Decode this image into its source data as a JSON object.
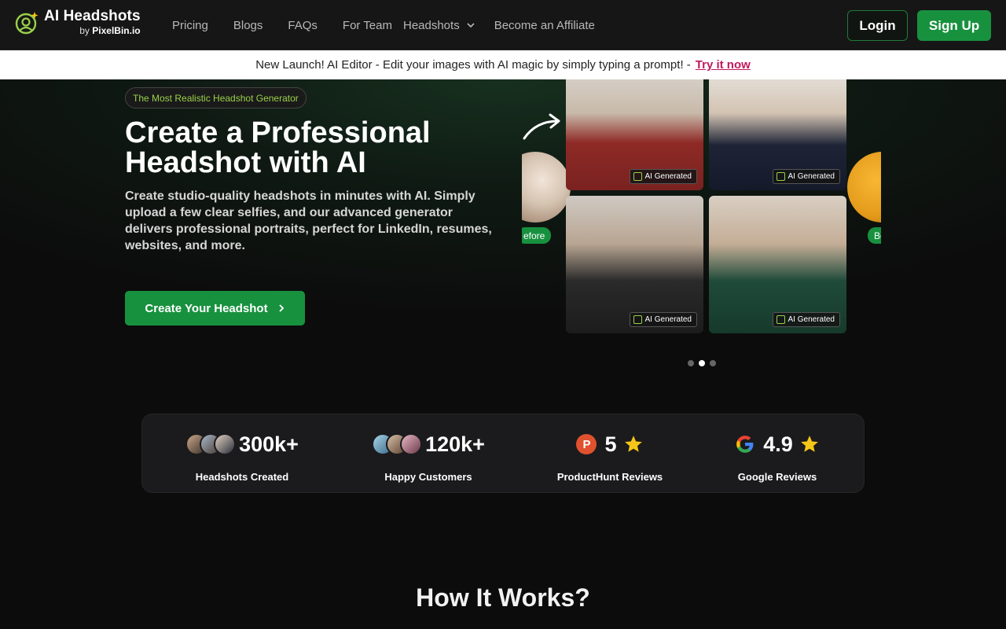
{
  "brand": {
    "name": "AI Headshots",
    "by_prefix": "by",
    "by_name": "PixelBin.io",
    "accent": "#9ad04a"
  },
  "nav": {
    "links": [
      "Pricing",
      "Blogs",
      "FAQs",
      "For Team"
    ],
    "dropdown": "Headshots",
    "affiliate": "Become an Affiliate",
    "login": "Login",
    "signup": "Sign Up"
  },
  "announcement": {
    "text": "New Launch! AI Editor - Edit your images with AI magic by simply typing a prompt! -",
    "link": "Try it now"
  },
  "hero": {
    "pill": "The Most Realistic Headshot Generator",
    "title": "Create a Professional Headshot with AI",
    "subtitle": "Create studio-quality headshots in minutes with AI. Simply upload a few clear selfies, and our advanced generator delivers professional portraits, perfect for LinkedIn, resumes, websites, and more.",
    "cta": "Create Your Headshot"
  },
  "carousel": {
    "badge": "AI Generated",
    "left_tag": "efore",
    "right_tag": "Be",
    "dots": 3,
    "active_dot": 1
  },
  "stats": [
    {
      "value": "300k+",
      "label": "Headshots Created",
      "icon": "avatars"
    },
    {
      "value": "120k+",
      "label": "Happy Customers",
      "icon": "avatars"
    },
    {
      "value": "5",
      "label": "ProductHunt Reviews",
      "icon": "producthunt-icon",
      "ph_letter": "P"
    },
    {
      "value": "4.9",
      "label": "Google Reviews",
      "icon": "google-icon"
    }
  ],
  "section": {
    "title": "How It Works?"
  },
  "colors": {
    "primary_green": "#18913f",
    "star": "#f5c518",
    "link_pink": "#c2185b"
  }
}
